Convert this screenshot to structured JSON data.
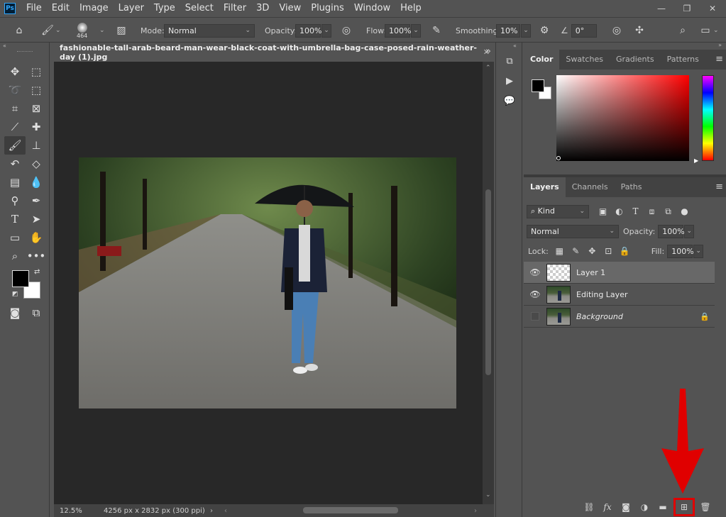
{
  "menubar": {
    "app_icon": "Ps",
    "items": [
      "File",
      "Edit",
      "Image",
      "Layer",
      "Type",
      "Select",
      "Filter",
      "3D",
      "View",
      "Plugins",
      "Window",
      "Help"
    ],
    "window_controls": [
      "minimize-icon",
      "restore-icon",
      "close-icon"
    ]
  },
  "options_bar": {
    "brush_size": "464",
    "mode_label": "Mode:",
    "mode_value": "Normal",
    "opacity_label": "Opacity:",
    "opacity_value": "100%",
    "flow_label": "Flow:",
    "flow_value": "100%",
    "smoothing_label": "Smoothing:",
    "smoothing_value": "10%",
    "angle_value": "0°"
  },
  "toolbar": {
    "tools": [
      [
        "move-icon",
        "marquee-icon"
      ],
      [
        "lasso-icon",
        "object-select-icon"
      ],
      [
        "crop-icon",
        "frame-icon"
      ],
      [
        "eyedropper-icon",
        "healing-icon"
      ],
      [
        "brush-icon",
        "stamp-icon"
      ],
      [
        "history-brush-icon",
        "eraser-icon"
      ],
      [
        "gradient-icon",
        "blur-icon"
      ],
      [
        "dodge-icon",
        "pen-icon"
      ],
      [
        "type-icon",
        "path-select-icon"
      ],
      [
        "rectangle-icon",
        "hand-icon"
      ],
      [
        "zoom-icon",
        "more-tools-icon"
      ]
    ],
    "active_tool": "brush-icon",
    "foreground_color": "#000000",
    "background_color": "#ffffff"
  },
  "document": {
    "tab_title": "fashionable-tall-arab-beard-man-wear-black-coat-with-umbrella-bag-case-posed-rain-weather-day (1).jpg",
    "zoom": "12.5%",
    "info": "4256 px x 2832 px (300 ppi)"
  },
  "color_panel": {
    "tabs": [
      "Color",
      "Swatches",
      "Gradients",
      "Patterns"
    ],
    "active_tab": "Color"
  },
  "layers_panel": {
    "tabs": [
      "Layers",
      "Channels",
      "Paths"
    ],
    "active_tab": "Layers",
    "filter_value": "Kind",
    "blend_mode": "Normal",
    "opacity_label": "Opacity:",
    "opacity_value": "100%",
    "lock_label": "Lock:",
    "fill_label": "Fill:",
    "fill_value": "100%",
    "layers": [
      {
        "name": "Layer 1",
        "visible": true,
        "selected": true,
        "thumb": "transparent"
      },
      {
        "name": "Editing Layer",
        "visible": true,
        "selected": false,
        "thumb": "photo"
      },
      {
        "name": "Background",
        "visible": false,
        "selected": false,
        "thumb": "photo",
        "locked": true
      }
    ],
    "footer_buttons": [
      "link-icon",
      "fx-icon",
      "mask-icon",
      "adjustment-icon",
      "group-folder-icon",
      "new-layer-icon",
      "trash-icon"
    ]
  },
  "annotation": {
    "arrow_color": "#e00000",
    "highlight_color": "#e00000"
  }
}
